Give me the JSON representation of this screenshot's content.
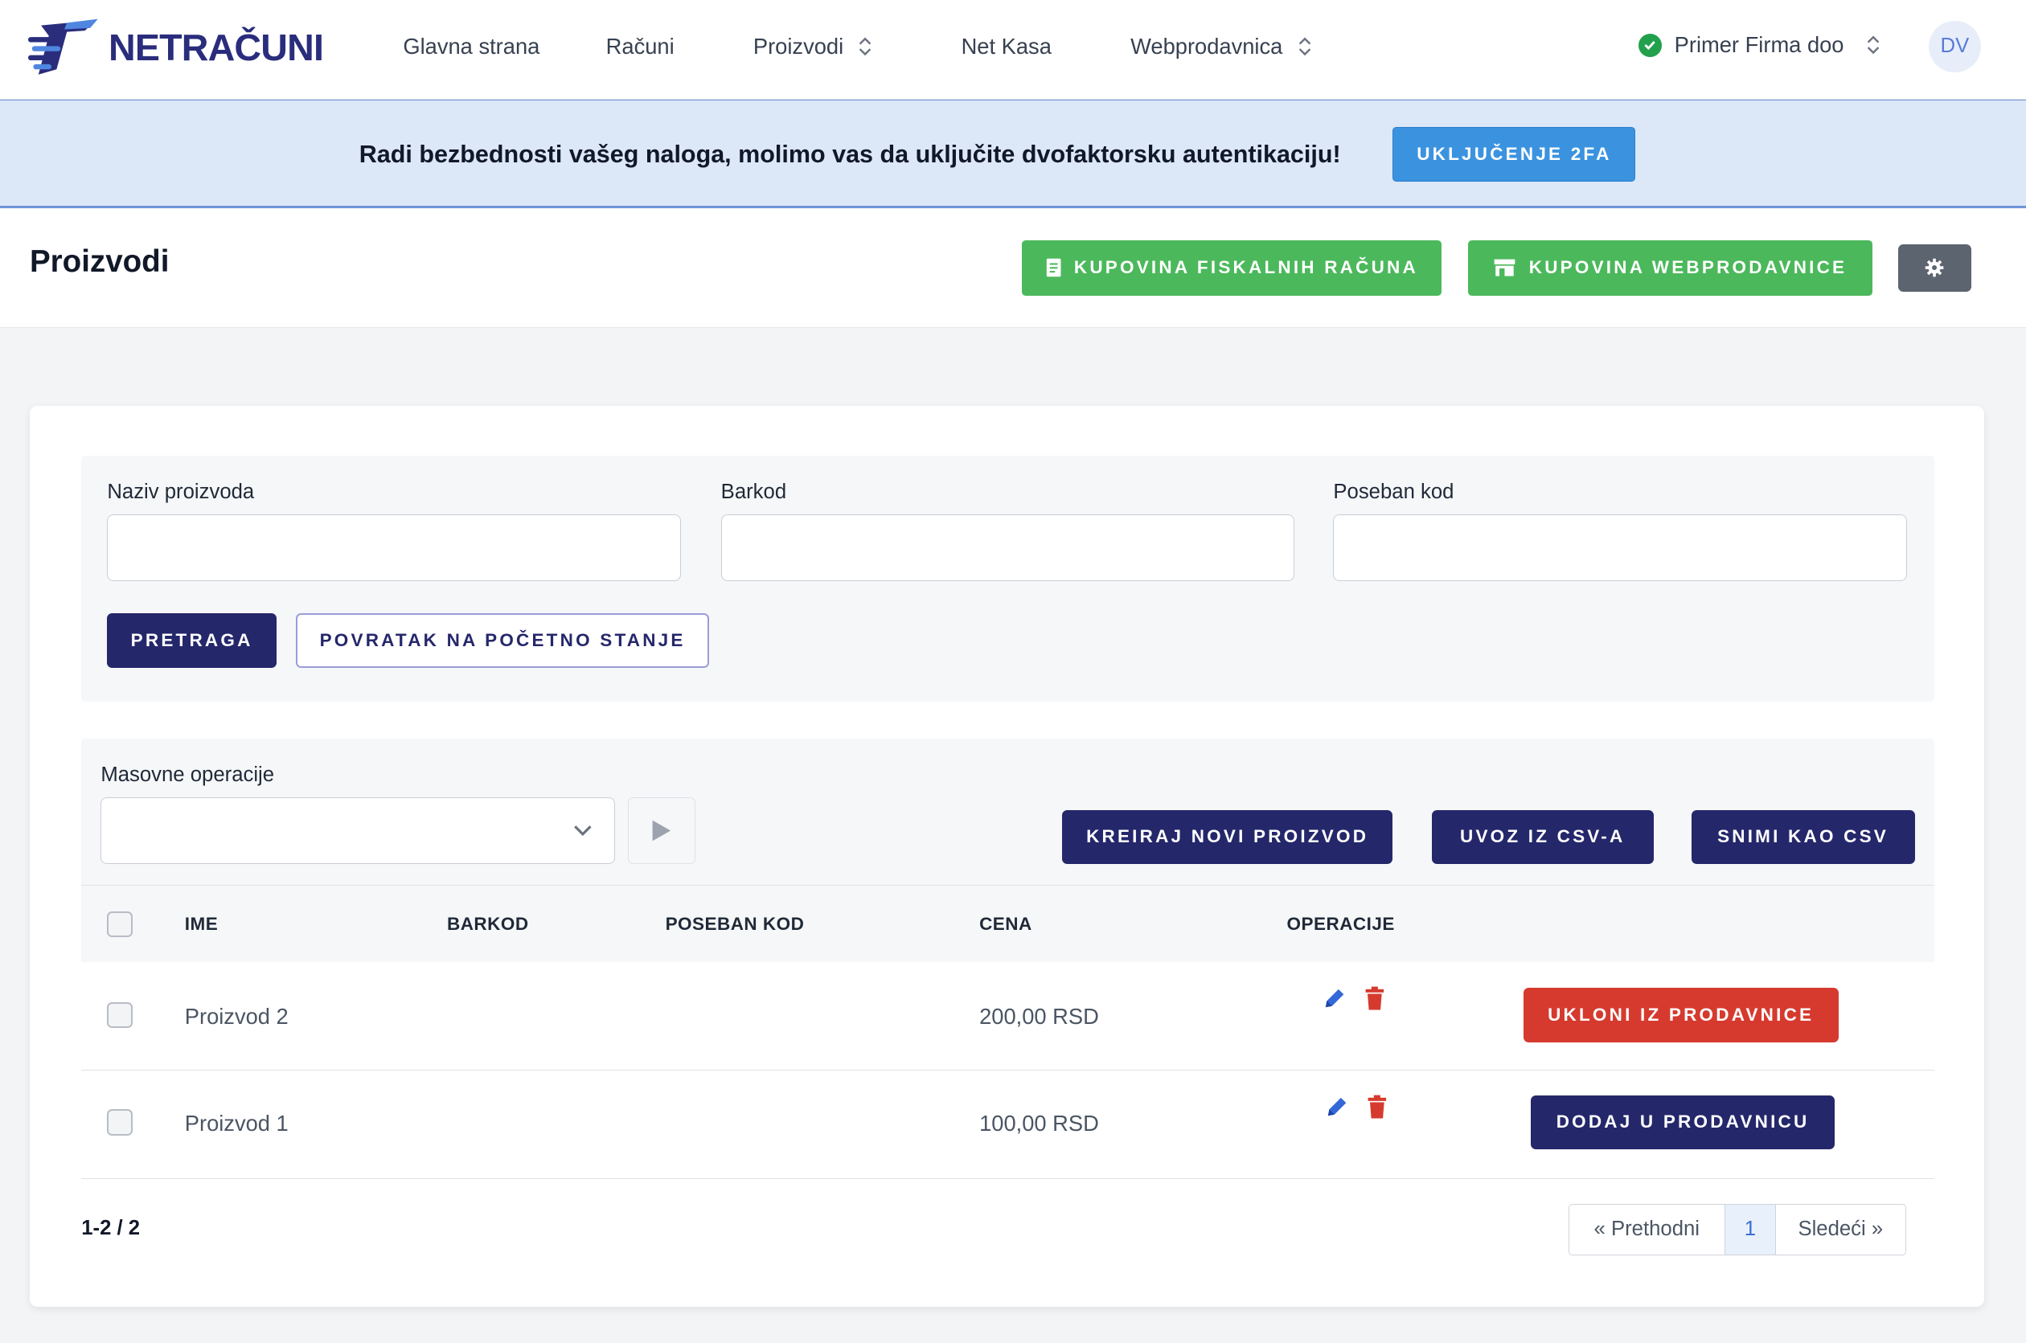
{
  "brand": {
    "name": "NETRAČUNI"
  },
  "nav": {
    "items": [
      {
        "label": "Glavna strana"
      },
      {
        "label": "Računi"
      },
      {
        "label": "Proizvodi"
      },
      {
        "label": "Net Kasa"
      },
      {
        "label": "Webprodavnica"
      }
    ],
    "company": "Primer Firma doo",
    "avatar": "DV"
  },
  "banner": {
    "text": "Radi bezbednosti vašeg naloga, molimo vas da uključite dvofaktorsku autentikaciju!",
    "button": "UKLJUČENJE 2FA"
  },
  "header": {
    "title": "Proizvodi",
    "buy_fiscal": "KUPOVINA FISKALNIH RAČUNA",
    "buy_webshop": "KUPOVINA WEBPRODAVNICE"
  },
  "filters": {
    "name_label": "Naziv proizvoda",
    "name_value": "",
    "barcode_label": "Barkod",
    "barcode_value": "",
    "code_label": "Poseban kod",
    "code_value": "",
    "search_button": "PRETRAGA",
    "reset_button": "POVRATAK NA POČETNO STANJE"
  },
  "bulk": {
    "label": "Masovne operacije",
    "selected": "",
    "create_button": "KREIRAJ NOVI PROIZVOD",
    "import_button": "UVOZ IZ CSV-A",
    "export_button": "SNIMI KAO CSV"
  },
  "table": {
    "columns": [
      "IME",
      "BARKOD",
      "POSEBAN KOD",
      "CENA",
      "OPERACIJE"
    ],
    "rows": [
      {
        "name": "Proizvod 2",
        "barcode": "",
        "code": "",
        "price": "200,00 RSD",
        "action": "UKLONI IZ PRODAVNICE"
      },
      {
        "name": "Proizvod 1",
        "barcode": "",
        "code": "",
        "price": "100,00 RSD",
        "action": "DODAJ U PRODAVNICU"
      }
    ]
  },
  "pagination": {
    "summary": "1-2 / 2",
    "prev": "« Prethodni",
    "current": "1",
    "next": "Sledeći »"
  },
  "colors": {
    "brand": "#2a2d7c",
    "navy_button": "#25276b",
    "green_button": "#4cb85c",
    "red_button": "#d63a2e",
    "banner_bg": "#dce7f8",
    "banner_button": "#3b93e0"
  }
}
